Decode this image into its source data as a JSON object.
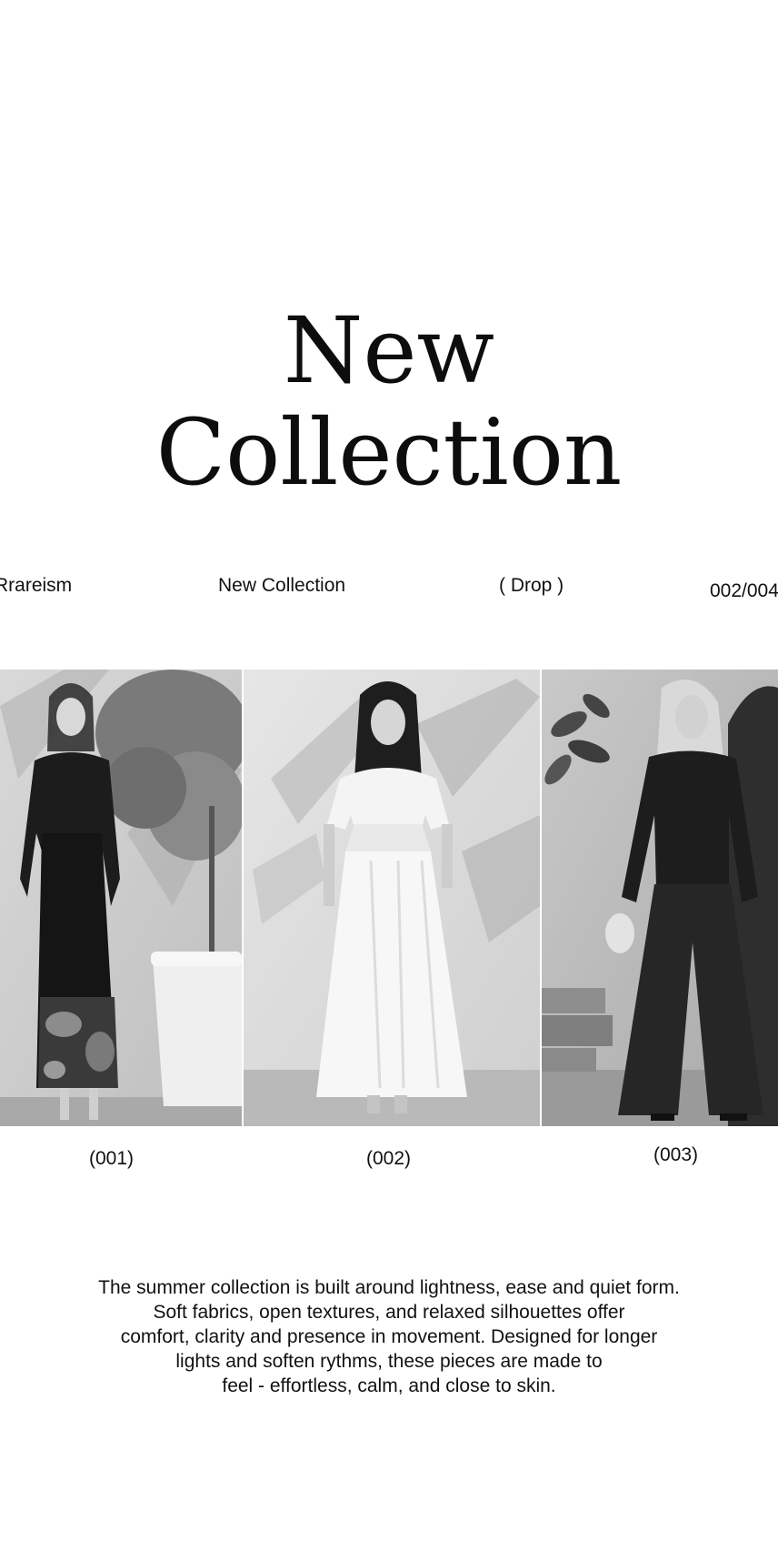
{
  "hero": {
    "title_line1": "New",
    "title_line2": "Collection"
  },
  "meta": {
    "brand": "Rrareism",
    "collection": "New Collection",
    "drop": "( Drop )",
    "index": "002/004"
  },
  "gallery": {
    "items": [
      {
        "caption": "(001)",
        "alt": "Model in black long-sleeve floral-hem dress beside potted olive tree"
      },
      {
        "caption": "(002)",
        "alt": "Model in white gathered maxi dress against sunlit wall"
      },
      {
        "caption": "(003)",
        "alt": "Model in black blouse and wide-leg trousers by a doorway"
      }
    ]
  },
  "description": {
    "lines": [
      "The summer collection is built around lightness, ease and quiet form.",
      "Soft fabrics, open textures, and relaxed silhouettes offer",
      "comfort, clarity and presence in movement. Designed for longer",
      "lights and soften rythms, these pieces are made to",
      "feel - effortless, calm, and close to skin."
    ]
  },
  "colors": {
    "background": "#ffffff",
    "text": "#111111"
  }
}
